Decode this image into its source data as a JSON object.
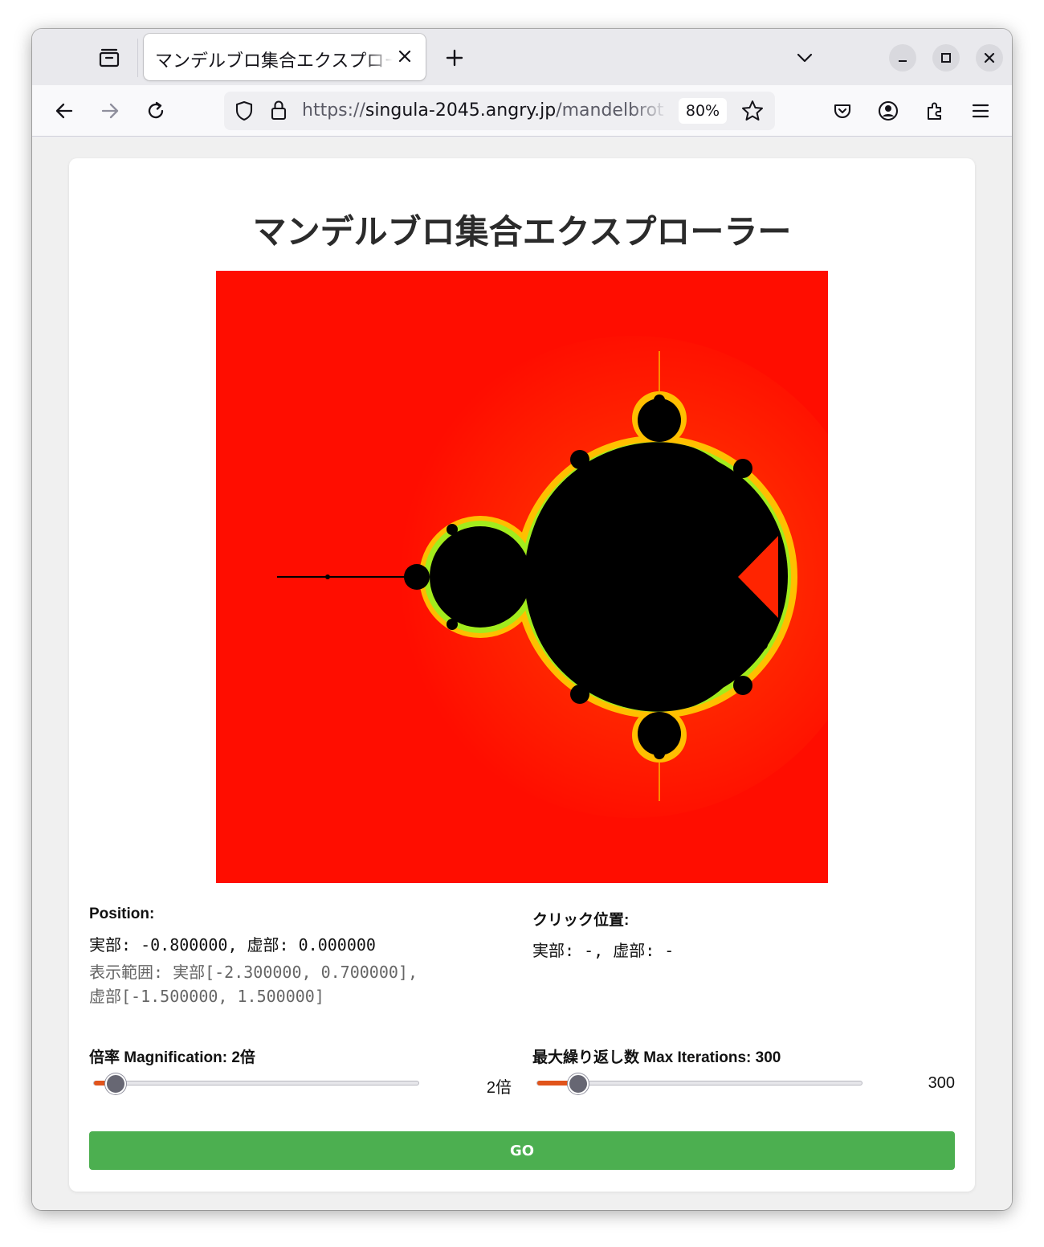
{
  "browser": {
    "tab_title": "マンデルブロ集合エクスプローラー",
    "url_prefix": "https://",
    "url_domain": "singula-2045.angry.jp",
    "url_path": "/mandelbrot",
    "zoom": "80%"
  },
  "page": {
    "title": "マンデルブロ集合エクスプローラー",
    "position": {
      "label": "Position:",
      "value": "実部: -0.800000, 虚部: 0.000000",
      "range": "表示範囲: 実部[-2.300000, 0.700000], 虚部[-1.500000, 1.500000]"
    },
    "click": {
      "label": "クリック位置:",
      "value": "実部: -, 虚部: -"
    },
    "magnification": {
      "label": "倍率 Magnification: 2倍",
      "value_text": "2倍",
      "level": 0.02
    },
    "iterations": {
      "label": "最大繰り返し数 Max Iterations: 300",
      "value_text": "300",
      "level": 0.08
    },
    "go_label": "GO"
  },
  "colors": {
    "background": "#ff0d00",
    "set": "#000000",
    "go_button": "#4caf50",
    "slider_fill": "#e1541b"
  }
}
